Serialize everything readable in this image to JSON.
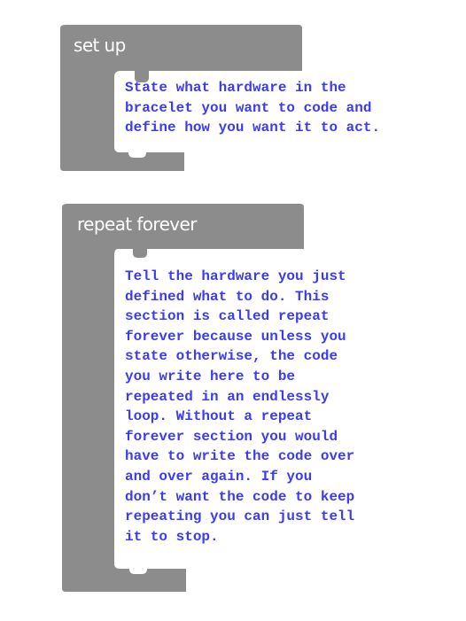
{
  "colors": {
    "block_gray": "#8c8c8c",
    "inner_white": "#ffffff",
    "text_blue": "#3b3bf5",
    "title_white": "#ffffff"
  },
  "setup_block": {
    "title": "set up",
    "description": "State what hardware in the\nbracelet you want to code and\ndefine how you want it to act."
  },
  "repeat_block": {
    "title": "repeat forever",
    "description": "Tell the hardware you just\ndefined what to do. This\nsection is called repeat\nforever because unless you\nstate otherwise, the code\nyou write here to be\nrepeated in an endlessly\nloop. Without a repeat\nforever section you would\nhave to write the code over\nand over again. If you\ndon’t want the code to keep\nrepeating you can just tell\nit to stop."
  }
}
